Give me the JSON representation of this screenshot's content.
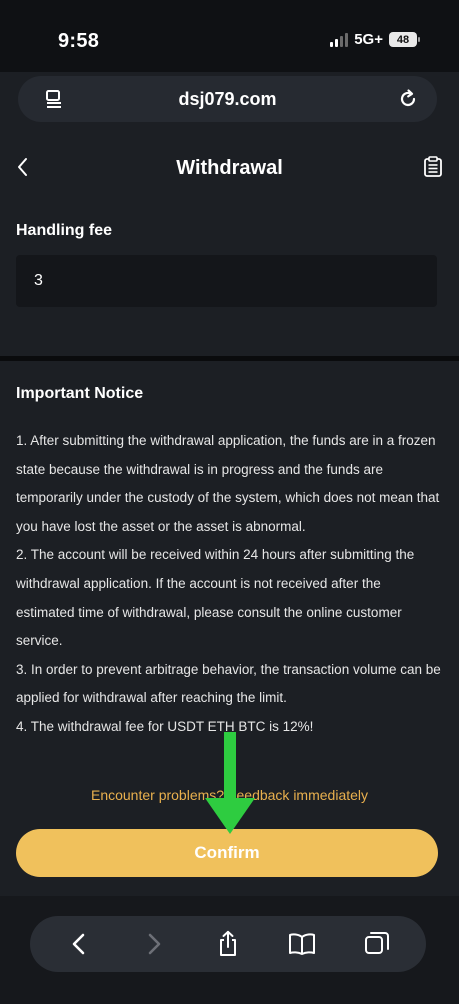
{
  "status_bar": {
    "time": "9:58",
    "network": "5G+",
    "battery": "48"
  },
  "browser": {
    "url": "dsj079.com"
  },
  "header": {
    "title": "Withdrawal"
  },
  "fee": {
    "label": "Handling fee",
    "value": "3"
  },
  "notice": {
    "title": "Important Notice",
    "items": [
      "1. After submitting the withdrawal application, the funds are in a frozen state because the withdrawal is in progress and the funds are temporarily under the custody of the system, which does not mean that you have lost the asset or the asset is abnormal.",
      "2. The account will be received within 24 hours after submitting the withdrawal application. If the account is not received after the estimated time of withdrawal, please consult the online customer service.",
      "3. In order to prevent arbitrage behavior, the transaction volume can be applied for withdrawal after reaching the limit.",
      "4. The withdrawal fee for USDT ETH BTC is 12%!"
    ]
  },
  "feedback_link": "Encounter problems? Feedback immediately",
  "confirm_label": "Confirm",
  "colors": {
    "accent": "#f0c15c",
    "link": "#e9b04e",
    "background": "#1c1f24",
    "overlay_arrow": "#2ecc40"
  },
  "icons": {
    "url_left": "reader-icon",
    "url_right": "reload-icon",
    "header_left": "chevron-left-icon",
    "header_right": "records-icon",
    "toolbar": [
      "back-icon",
      "forward-icon",
      "share-icon",
      "bookmarks-icon",
      "tabs-icon"
    ]
  }
}
